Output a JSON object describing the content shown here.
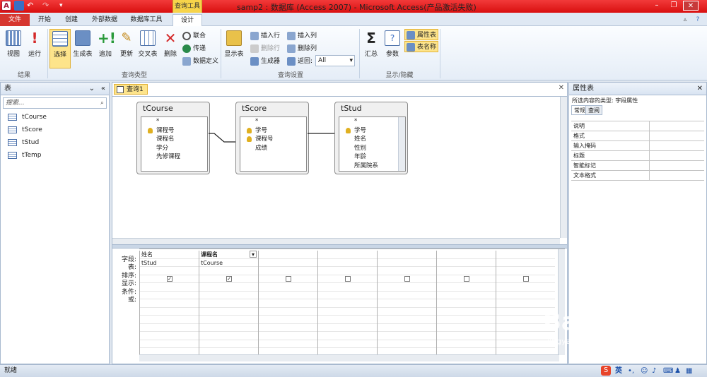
{
  "window": {
    "title": "samp2 : 数据库 (Access 2007) - Microsoft Access(产品激活失败)",
    "context_tab": "查询工具",
    "app_icon": "A"
  },
  "tabs": [
    "文件",
    "开始",
    "创建",
    "外部数据",
    "数据库工具",
    "设计"
  ],
  "ribbon": {
    "groups": {
      "results": "结果",
      "query_type": "查询类型",
      "query_setup": "查询设置",
      "show_hide": "显示/隐藏"
    },
    "buttons": {
      "view": "视图",
      "run": "运行",
      "select": "选择",
      "make_table": "生成表",
      "append": "追加",
      "update": "更新",
      "crosstab": "交叉表",
      "delete": "删除",
      "union": "联合",
      "pass_through": "传递",
      "data_definition": "数据定义",
      "show_table": "显示表",
      "insert_rows": "插入行",
      "delete_rows": "删除行",
      "builder": "生成器",
      "insert_columns": "插入列",
      "delete_columns": "删除列",
      "return_label": "返回:",
      "return_value": "All",
      "totals": "汇总",
      "parameters": "参数",
      "property_sheet": "属性表",
      "table_names": "表名称"
    }
  },
  "nav": {
    "header": "表",
    "search_placeholder": "搜索...",
    "items": [
      "tCourse",
      "tScore",
      "tStud",
      "tTemp"
    ]
  },
  "document": {
    "tab_label": "查询1",
    "tables": [
      {
        "name": "tCourse",
        "fields": [
          {
            "text": "*",
            "key": false
          },
          {
            "text": "课程号",
            "key": true
          },
          {
            "text": "课程名",
            "key": false
          },
          {
            "text": "学分",
            "key": false
          },
          {
            "text": "先修课程",
            "key": false
          }
        ]
      },
      {
        "name": "tScore",
        "fields": [
          {
            "text": "*",
            "key": false
          },
          {
            "text": "学号",
            "key": true
          },
          {
            "text": "课程号",
            "key": true
          },
          {
            "text": "成绩",
            "key": false
          }
        ]
      },
      {
        "name": "tStud",
        "fields": [
          {
            "text": "*",
            "key": false
          },
          {
            "text": "学号",
            "key": true
          },
          {
            "text": "姓名",
            "key": false
          },
          {
            "text": "性别",
            "key": false
          },
          {
            "text": "年龄",
            "key": false
          },
          {
            "text": "所属院系",
            "key": false
          }
        ]
      }
    ],
    "grid": {
      "row_labels": [
        "字段:",
        "表:",
        "排序:",
        "显示:",
        "条件:",
        "或:"
      ],
      "columns": [
        {
          "field": "姓名",
          "table": "tStud",
          "show": true
        },
        {
          "field": "课程名",
          "table": "tCourse",
          "show": true
        },
        {
          "field": "",
          "table": "",
          "show": false
        },
        {
          "field": "",
          "table": "",
          "show": false
        },
        {
          "field": "",
          "table": "",
          "show": false
        },
        {
          "field": "",
          "table": "",
          "show": false
        },
        {
          "field": "",
          "table": "",
          "show": false
        }
      ]
    }
  },
  "props": {
    "header": "属性表",
    "selection_type": "所选内容的类型: 字段属性",
    "tabs": [
      "常规",
      "查阅"
    ],
    "rows": [
      "说明",
      "格式",
      "输入掩码",
      "标题",
      "智能标记",
      "文本格式"
    ]
  },
  "status": "就绪",
  "tray": {
    "ime": "英"
  },
  "watermark": {
    "brand": "Bai 经验",
    "url": "jingyan.baidu.com"
  }
}
